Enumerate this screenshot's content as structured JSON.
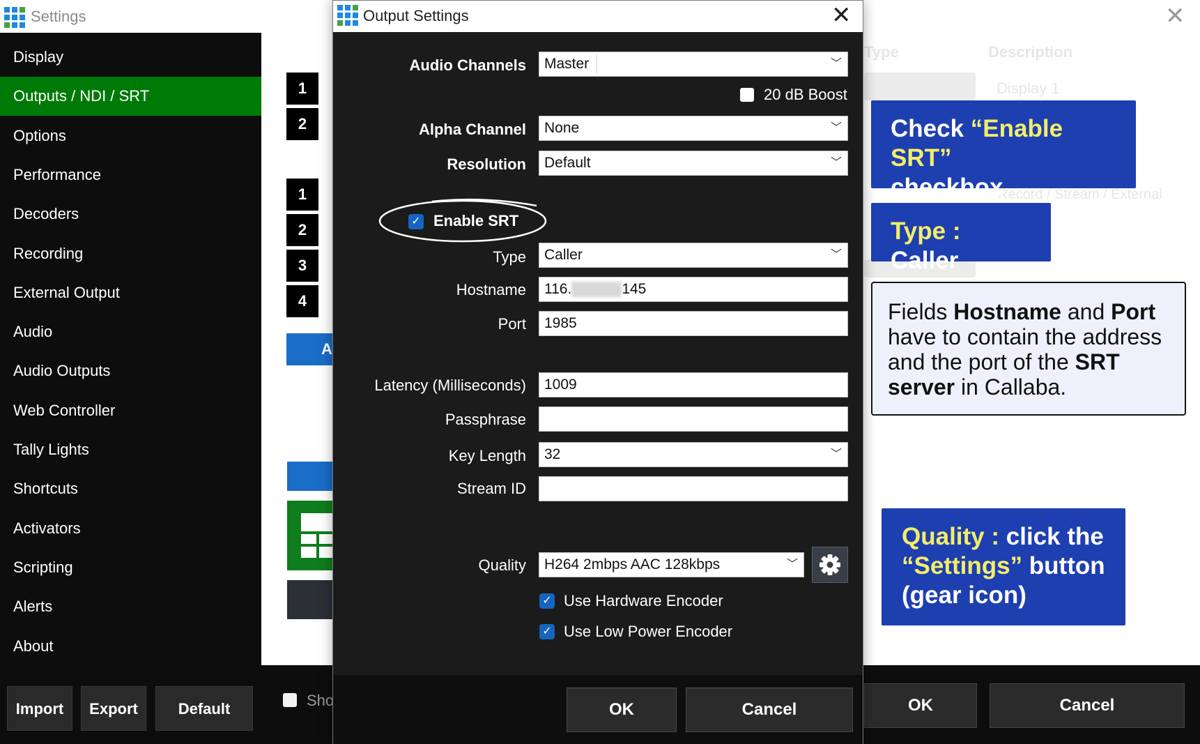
{
  "settings_window": {
    "title": "Settings",
    "sidebar_items": [
      {
        "label": "Display",
        "active": false
      },
      {
        "label": "Outputs / NDI / SRT",
        "active": true
      },
      {
        "label": "Options",
        "active": false
      },
      {
        "label": "Performance",
        "active": false
      },
      {
        "label": "Decoders",
        "active": false
      },
      {
        "label": "Recording",
        "active": false
      },
      {
        "label": "External Output",
        "active": false
      },
      {
        "label": "Audio",
        "active": false
      },
      {
        "label": "Audio Outputs",
        "active": false
      },
      {
        "label": "Web Controller",
        "active": false
      },
      {
        "label": "Tally Lights",
        "active": false
      },
      {
        "label": "Shortcuts",
        "active": false
      },
      {
        "label": "Activators",
        "active": false
      },
      {
        "label": "Scripting",
        "active": false
      },
      {
        "label": "Alerts",
        "active": false
      },
      {
        "label": "About",
        "active": false
      }
    ],
    "footer_buttons": {
      "import": "Import",
      "export": "Export",
      "default": "Default"
    },
    "output_numbers_a": [
      "1",
      "2"
    ],
    "output_numbers_b": [
      "1",
      "2",
      "3",
      "4"
    ],
    "blue_button_partial": "A",
    "show_checkbox_partial": "Sho",
    "ok": "OK",
    "cancel": "Cancel",
    "ghost_headers": {
      "type": "Type",
      "description": "Description"
    },
    "ghost_row1": "Display 1",
    "ghost_row2": "Record / Stream / External"
  },
  "dialog": {
    "title": "Output Settings",
    "audio_channels_label": "Audio Channels",
    "audio_channels_value": "Master",
    "boost_label": "20 dB Boost",
    "alpha_channel_label": "Alpha Channel",
    "alpha_channel_value": "None",
    "resolution_label": "Resolution",
    "resolution_value": "Default",
    "enable_srt_label": "Enable SRT",
    "type_label": "Type",
    "type_value": "Caller",
    "hostname_label": "Hostname",
    "hostname_prefix": "116.",
    "hostname_suffix": "145",
    "port_label": "Port",
    "port_value": "1985",
    "latency_label": "Latency (Milliseconds)",
    "latency_value": "1009",
    "passphrase_label": "Passphrase",
    "passphrase_value": "",
    "key_length_label": "Key Length",
    "key_length_value": "32",
    "stream_id_label": "Stream ID",
    "stream_id_value": "",
    "quality_label": "Quality",
    "quality_value": "H264 2mbps AAC 128kbps",
    "hw_encoder_label": "Use Hardware Encoder",
    "low_power_label": "Use Low Power Encoder",
    "ok": "OK",
    "cancel": "Cancel"
  },
  "callouts": {
    "srt_line1_pre": "Check ",
    "srt_line1_hl": "“Enable SRT”",
    "srt_line2": "checkbox",
    "type_hl": "Type : ",
    "type_val": "Caller",
    "fields_1": "Fields ",
    "fields_hostname": "Hostname",
    "fields_and": " and ",
    "fields_port": "Port",
    "fields_2": " have to contain the address and the port of the ",
    "fields_srt_server": "SRT server",
    "fields_3": " in Callaba.",
    "quality_hl": "Quality : ",
    "quality_1": "click the",
    "quality_hl2": "“Settings”",
    "quality_2": " button",
    "quality_3": "(gear icon)"
  },
  "colors": {
    "active_green": "#007a07",
    "callout_blue": "#1e3fb0",
    "highlight_yellow": "#f2ee6a",
    "checkbox_blue": "#1565c0"
  },
  "icons": [
    "app-logo-icon",
    "close-icon",
    "chevron-down-icon",
    "checkmark-icon",
    "gear-icon"
  ]
}
